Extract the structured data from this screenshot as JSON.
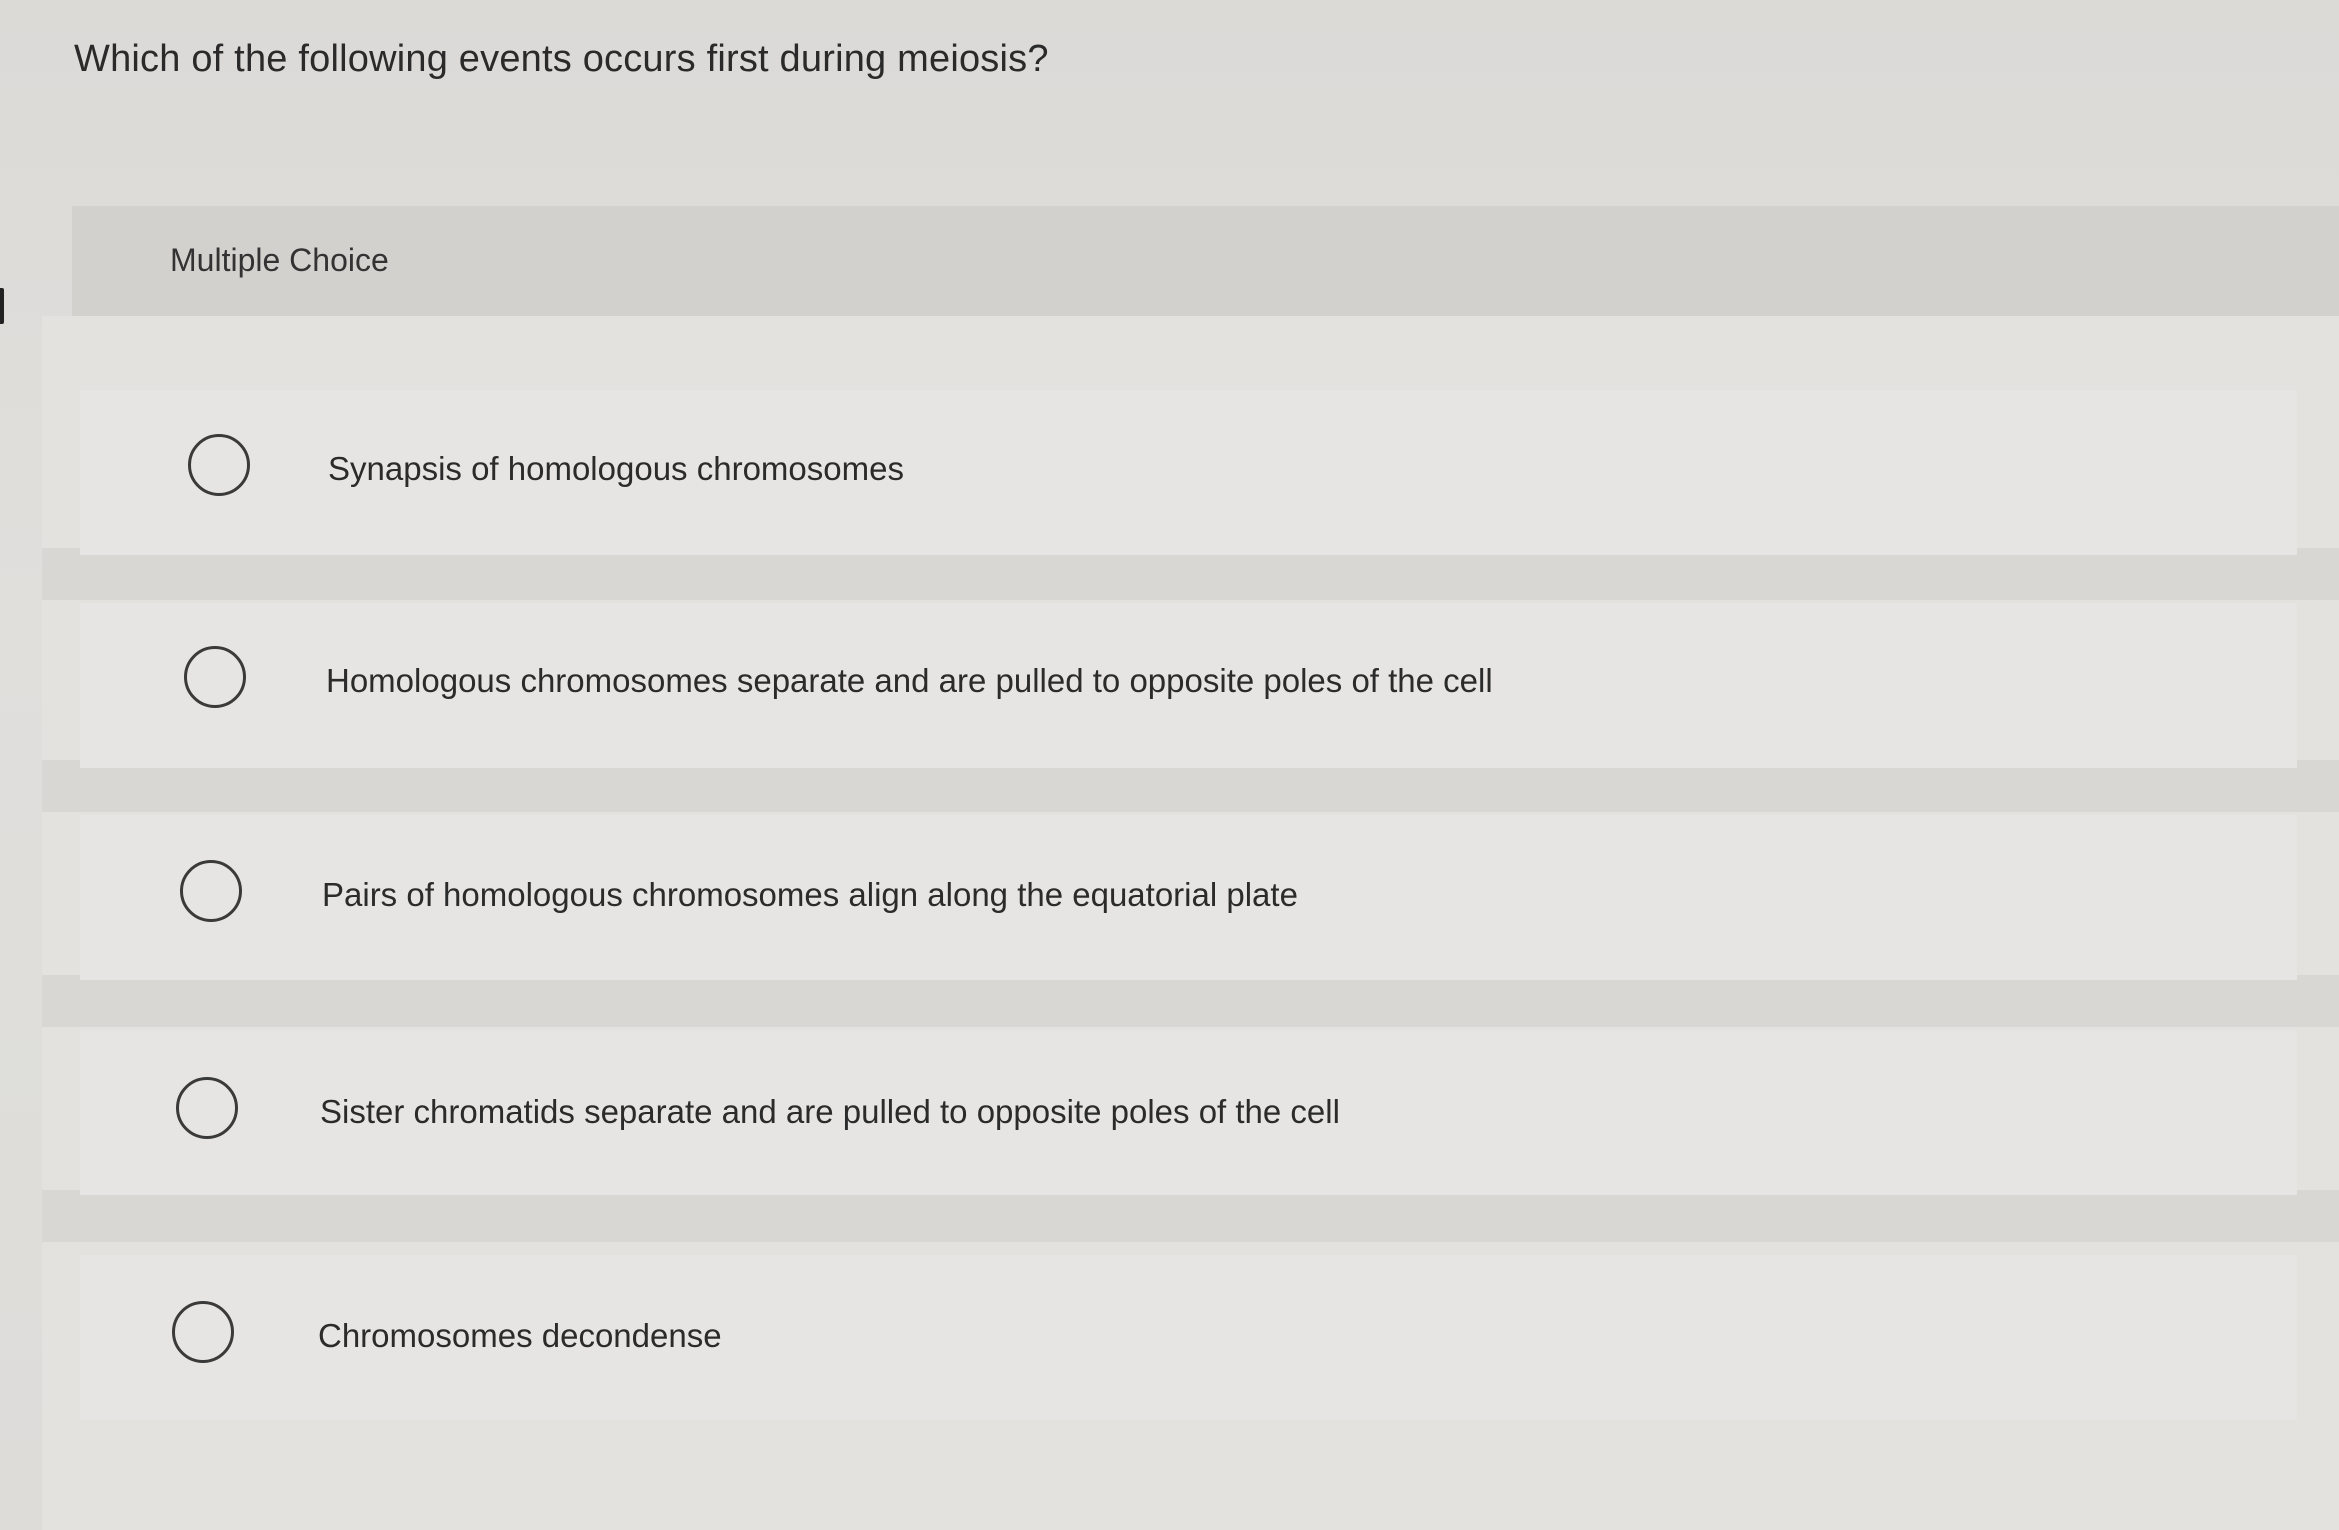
{
  "question": {
    "text": "Which of the following events occurs first during meiosis?"
  },
  "question_type": {
    "label": "Multiple Choice"
  },
  "options": [
    {
      "label": "Synapsis of homologous chromosomes",
      "selected": false
    },
    {
      "label": "Homologous chromosomes separate and are pulled to opposite poles of the cell",
      "selected": false
    },
    {
      "label": "Pairs of homologous chromosomes align along the equatorial plate",
      "selected": false
    },
    {
      "label": "Sister chromatids separate and are pulled to opposite poles of the cell",
      "selected": false
    },
    {
      "label": "Chromosomes decondense",
      "selected": false
    }
  ],
  "icons": {
    "radio": "radio-unselected-icon"
  }
}
